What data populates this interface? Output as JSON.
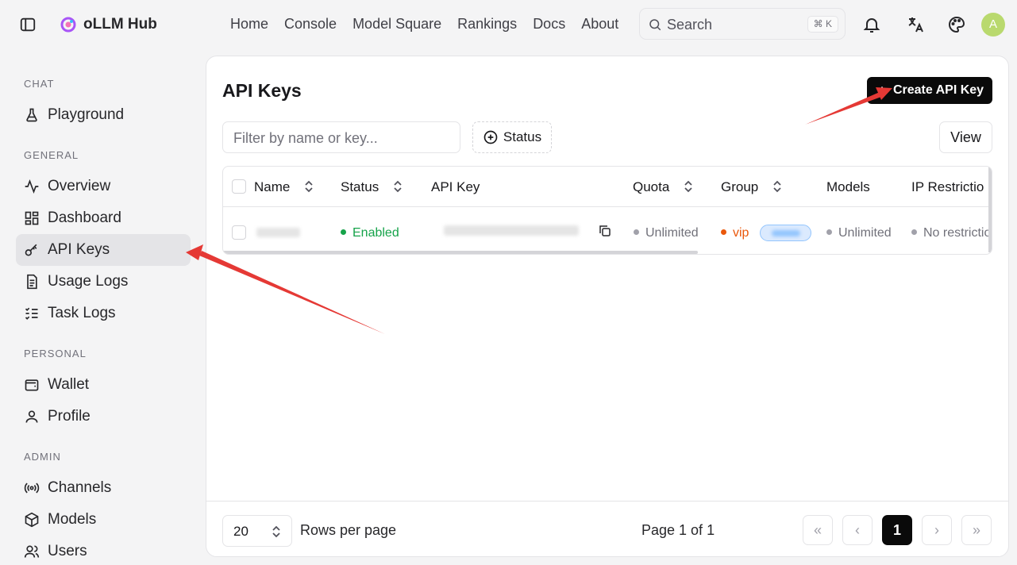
{
  "app": {
    "name": "oLLM Hub"
  },
  "nav": [
    "Home",
    "Console",
    "Model Square",
    "Rankings",
    "Docs",
    "About"
  ],
  "search": {
    "placeholder": "Search",
    "shortcut": "⌘ K"
  },
  "user": {
    "avatar_letter": "A"
  },
  "sidebar": {
    "sections": {
      "chat": "CHAT",
      "general": "GENERAL",
      "personal": "PERSONAL",
      "admin": "ADMIN"
    },
    "items": {
      "playground": "Playground",
      "overview": "Overview",
      "dashboard": "Dashboard",
      "api_keys": "API Keys",
      "usage_logs": "Usage Logs",
      "task_logs": "Task Logs",
      "wallet": "Wallet",
      "profile": "Profile",
      "channels": "Channels",
      "models": "Models",
      "users": "Users"
    },
    "active": "API Keys"
  },
  "page": {
    "title": "API Keys",
    "create_button": "Create API Key",
    "filter_placeholder": "Filter by name or key...",
    "status_filter": "Status",
    "view_button": "View"
  },
  "table": {
    "columns": {
      "name": "Name",
      "status": "Status",
      "api_key": "API Key",
      "quota": "Quota",
      "group": "Group",
      "models": "Models",
      "ip": "IP Restrictio"
    },
    "rows": [
      {
        "status": "Enabled",
        "quota": "Unlimited",
        "group": "vip",
        "models": "Unlimited",
        "ip": "No restrictio"
      }
    ]
  },
  "pagination": {
    "rows_per_page": "20",
    "rows_label": "Rows per page",
    "page_label": "Page 1 of 1",
    "current_page": "1"
  },
  "colors": {
    "accent": "#0a0a0a",
    "enabled": "#16a34a",
    "vip": "#ea580c",
    "annotation": "#e53935"
  }
}
